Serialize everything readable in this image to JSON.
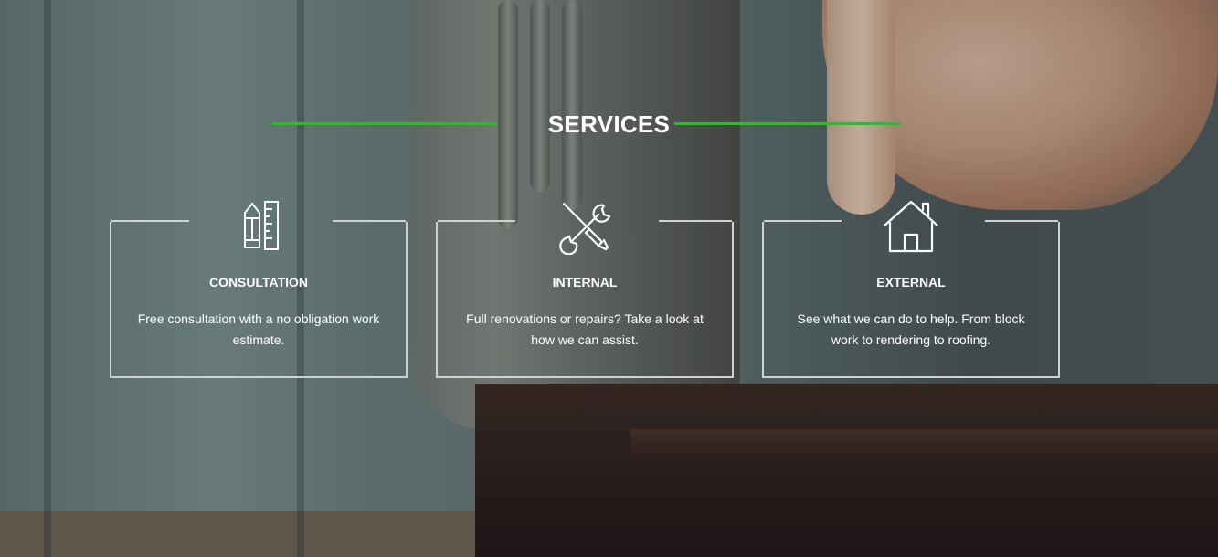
{
  "section": {
    "title": "SERVICES",
    "accent_color": "#3fae3c"
  },
  "services": [
    {
      "icon": "pencil-ruler-icon",
      "title": "CONSULTATION",
      "description": "Free consultation with a no obligation work estimate."
    },
    {
      "icon": "tools-icon",
      "title": "INTERNAL",
      "description": "Full renovations or repairs? Take a look at how we can assist."
    },
    {
      "icon": "house-icon",
      "title": "EXTERNAL",
      "description": "See what we can do to help. From block work to rendering to roofing."
    }
  ]
}
